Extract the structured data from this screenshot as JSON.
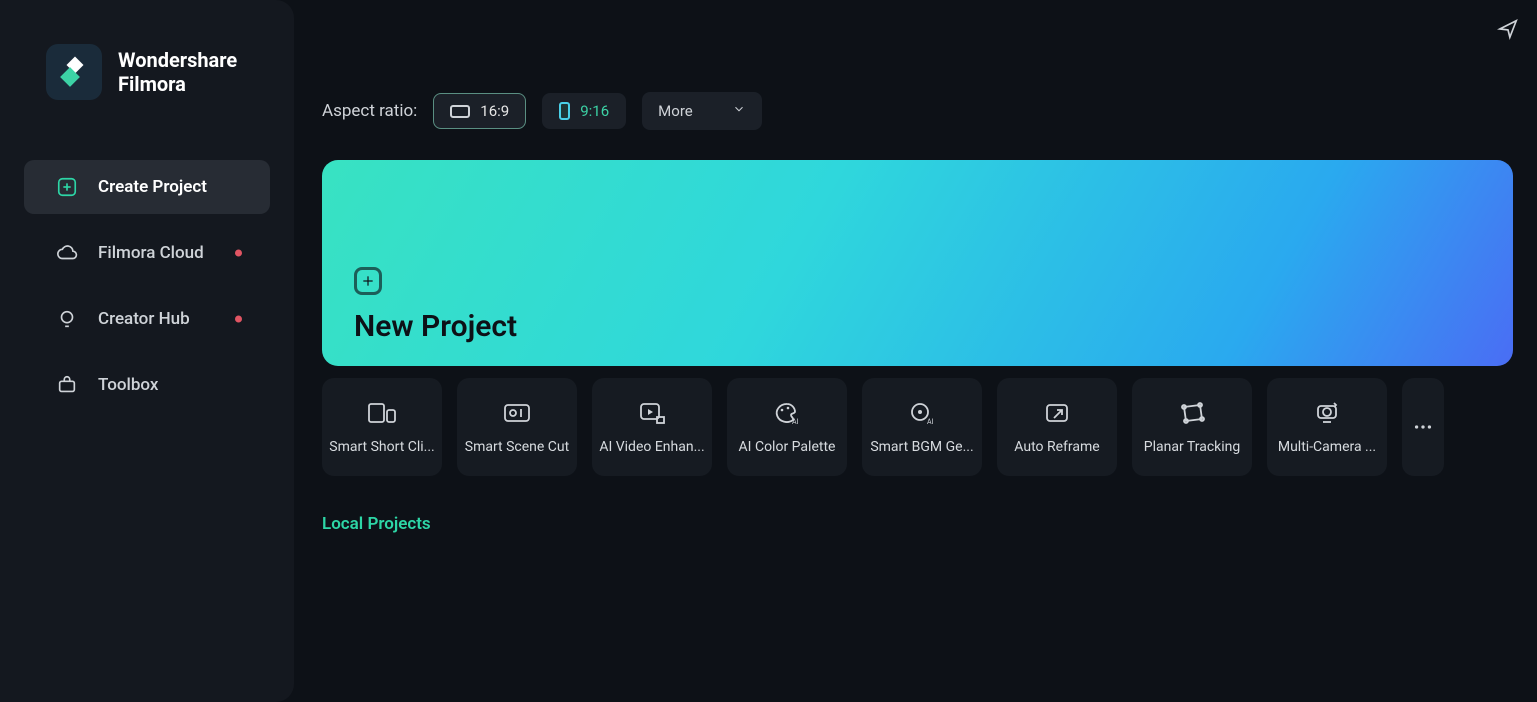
{
  "brand": {
    "line1": "Wondershare",
    "line2": "Filmora"
  },
  "sidebar": {
    "items": [
      {
        "label": "Create Project",
        "active": true,
        "icon": "create-project-icon",
        "dot": false
      },
      {
        "label": "Filmora Cloud",
        "active": false,
        "icon": "cloud-icon",
        "dot": true
      },
      {
        "label": "Creator Hub",
        "active": false,
        "icon": "bulb-icon",
        "dot": true
      },
      {
        "label": "Toolbox",
        "active": false,
        "icon": "toolbox-icon",
        "dot": false
      }
    ]
  },
  "aspect": {
    "label": "Aspect ratio:",
    "options": [
      {
        "value": "16:9",
        "selected": true,
        "kind": "landscape"
      },
      {
        "value": "9:16",
        "selected": false,
        "kind": "portrait"
      }
    ],
    "more_label": "More"
  },
  "hero": {
    "title": "New Project"
  },
  "tools": [
    {
      "label": "Smart Short Cli...",
      "icon": "smart-short-clips-icon"
    },
    {
      "label": "Smart Scene Cut",
      "icon": "smart-scene-cut-icon"
    },
    {
      "label": "AI Video Enhan...",
      "icon": "ai-video-enhancer-icon"
    },
    {
      "label": "AI Color Palette",
      "icon": "ai-color-palette-icon"
    },
    {
      "label": "Smart BGM Ge...",
      "icon": "smart-bgm-generator-icon"
    },
    {
      "label": "Auto Reframe",
      "icon": "auto-reframe-icon"
    },
    {
      "label": "Planar Tracking",
      "icon": "planar-tracking-icon"
    },
    {
      "label": "Multi-Camera ...",
      "icon": "multi-camera-icon"
    }
  ],
  "sections": {
    "local_projects": "Local Projects"
  }
}
